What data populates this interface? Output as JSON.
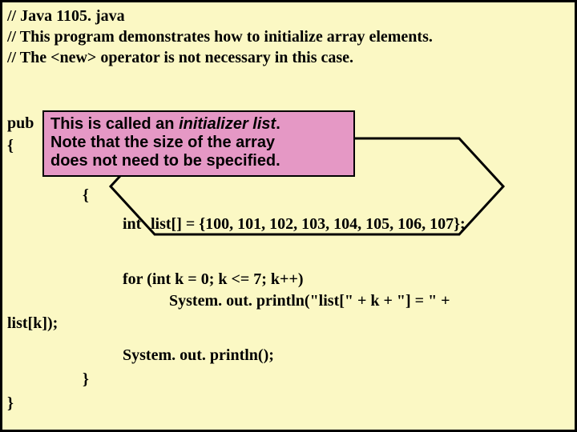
{
  "comment1": "// Java 1105. java",
  "comment2": "// This program demonstrates how to initialize array elements.",
  "comment3": "// The <new> operator is not necessary in this case.",
  "pub_fragment": "pub",
  "open_brace1": "{",
  "open_brace2": "{",
  "decl_int": "int",
  "decl_list": "list[] = {100, 101, 102, 103, 104, 105, 106, 107};",
  "for_line": "for (int k = 0; k <= 7; k++)",
  "println1_indent": "        ",
  "println1": "System. out. println(\"list[\" + k + \"] = \" + ",
  "listk": "list[k]);",
  "println2": "System. out. println();",
  "close_brace1": "}",
  "close_brace2": "}",
  "callout_l1a": "This is called an ",
  "callout_l1b": "initializer list",
  "callout_l1c": ".",
  "callout_l2": "Note that the size of the array",
  "callout_l3": "does not need to be specified."
}
